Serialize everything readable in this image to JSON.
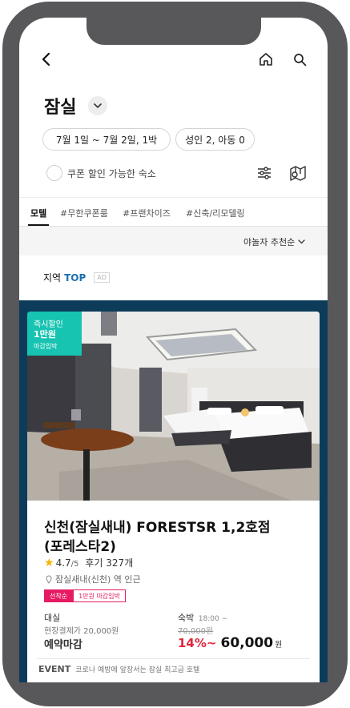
{
  "header": {
    "city": "잠실"
  },
  "chips": {
    "date": "7월 1일 ~ 7월 2일, 1박",
    "guests": "성인 2, 아동 0"
  },
  "coupon_filter": {
    "label": "쿠폰 할인 가능한 숙소"
  },
  "tabs": [
    {
      "label": "모텔",
      "active": true
    },
    {
      "label": "#무한쿠폰룸",
      "active": false
    },
    {
      "label": "#프랜차이즈",
      "active": false
    },
    {
      "label": "#신축/리모델링",
      "active": false
    }
  ],
  "sort": {
    "label": "야놀자 추천순"
  },
  "section": {
    "title_prefix": "지역",
    "title_highlight": "TOP",
    "ad_label": "AD"
  },
  "colors": {
    "accent_blue": "#1b6fb0",
    "badge_teal": "#17c3b1",
    "banner_navy": "#0c3c5a",
    "price_red": "#e2253d",
    "tag_pink": "#e61b63",
    "star": "#f5b400"
  },
  "listing": {
    "badge": {
      "line1": "즉시할인",
      "line2": "1만원",
      "line3": "마감임박"
    },
    "name_line1": "신천(잠실새내) FORESTSR 1,2호점",
    "name_line2": "(포레스타2)",
    "rating": "4.7",
    "rating_max": "/5",
    "reviews": "후기 327개",
    "location": "잠실새내(신천) 역 인근",
    "tags": [
      "선착순",
      "1만원 마감임박"
    ],
    "rental": {
      "label": "대실",
      "note": "현장결제가 20,000원",
      "status": "예약마감"
    },
    "stay": {
      "label": "숙박",
      "time": "18:00 ~",
      "original_price": "70,000원",
      "discount": "14%~",
      "price": "60,000",
      "unit": "원"
    },
    "event": {
      "label": "EVENT",
      "text": "코로나 예방에 앞장서는 잠실 최고급 호텔"
    }
  }
}
